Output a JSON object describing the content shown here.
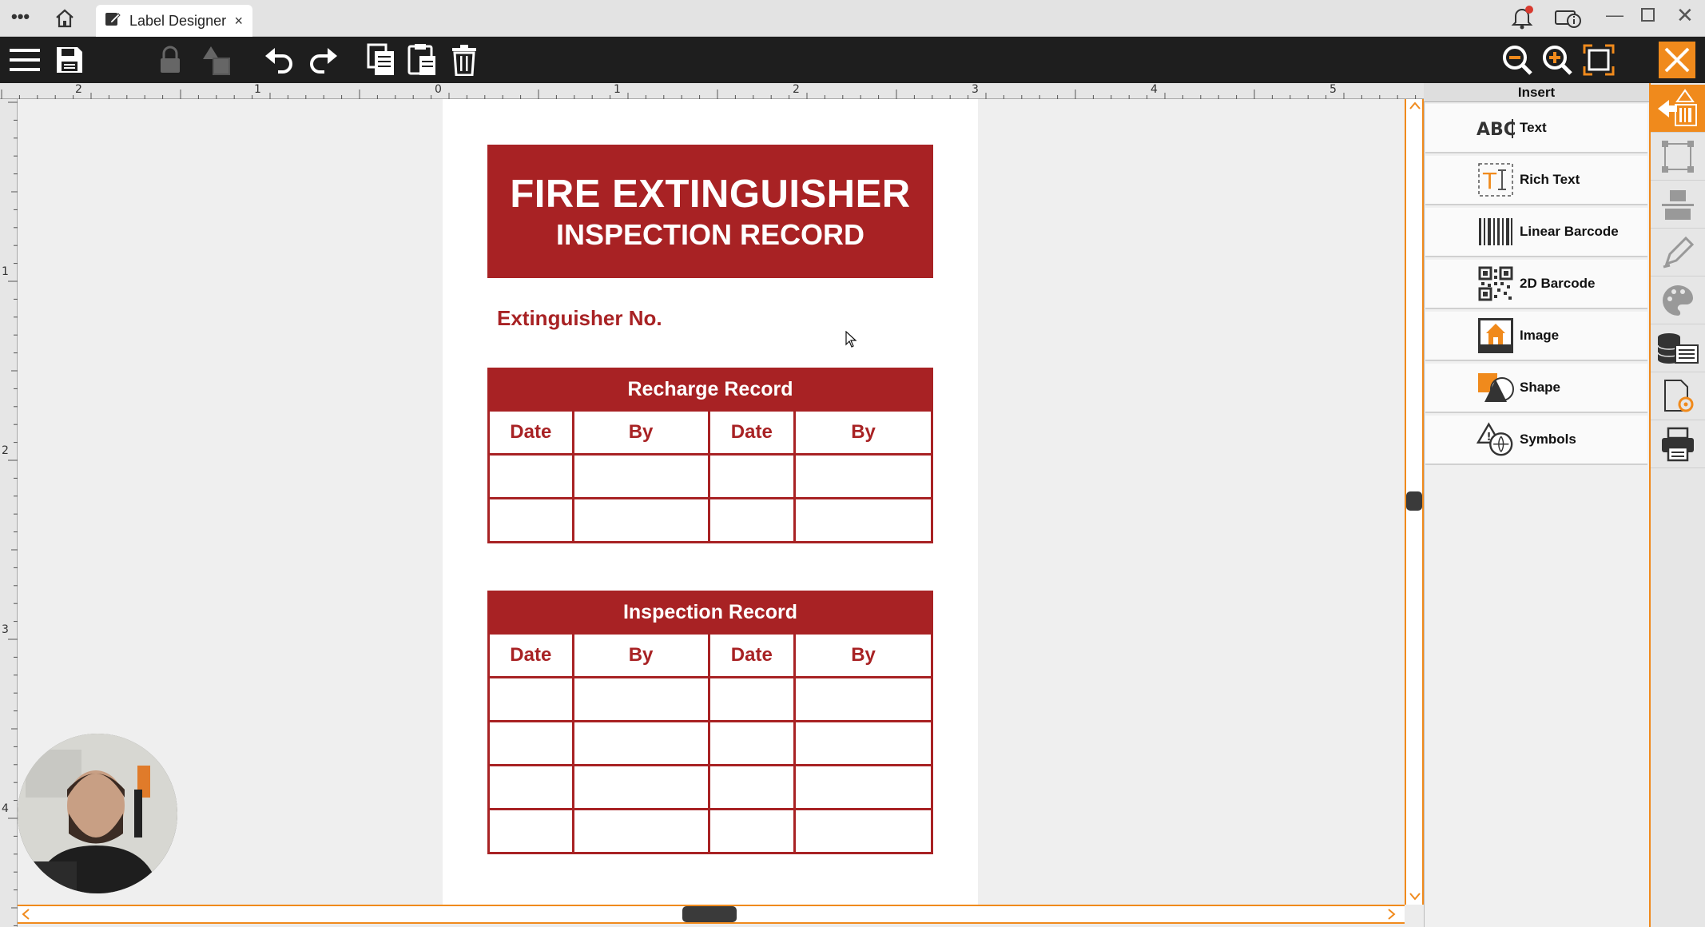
{
  "window": {
    "tab_title": "Label Designer",
    "tab_close": "×"
  },
  "label": {
    "title_line1": "FIRE EXTINGUISHER",
    "title_line2": "INSPECTION RECORD",
    "extinguisher_label": "Extinguisher No.",
    "recharge": {
      "title": "Recharge Record",
      "columns": [
        "Date",
        "By",
        "Date",
        "By"
      ],
      "empty_rows": 2
    },
    "inspection": {
      "title": "Inspection Record",
      "columns": [
        "Date",
        "By",
        "Date",
        "By"
      ],
      "empty_rows": 4
    }
  },
  "ruler": {
    "top_ticks": [
      "2",
      "1",
      "0",
      "1",
      "2",
      "3",
      "4",
      "5"
    ],
    "left_ticks": [
      "1",
      "2",
      "3",
      "4"
    ]
  },
  "insert_panel": {
    "title": "Insert",
    "items": [
      {
        "label": "Text",
        "icon": "text-abc-icon"
      },
      {
        "label": "Rich Text",
        "icon": "rich-text-icon"
      },
      {
        "label": "Linear Barcode",
        "icon": "linear-barcode-icon"
      },
      {
        "label": "2D Barcode",
        "icon": "qr-code-icon"
      },
      {
        "label": "Image",
        "icon": "image-icon"
      },
      {
        "label": "Shape",
        "icon": "shape-icon"
      },
      {
        "label": "Symbols",
        "icon": "symbols-icon"
      }
    ]
  },
  "colors": {
    "label_red": "#a82224",
    "accent_orange": "#f08a1c",
    "toolbar_bg": "#1e1e1e"
  }
}
